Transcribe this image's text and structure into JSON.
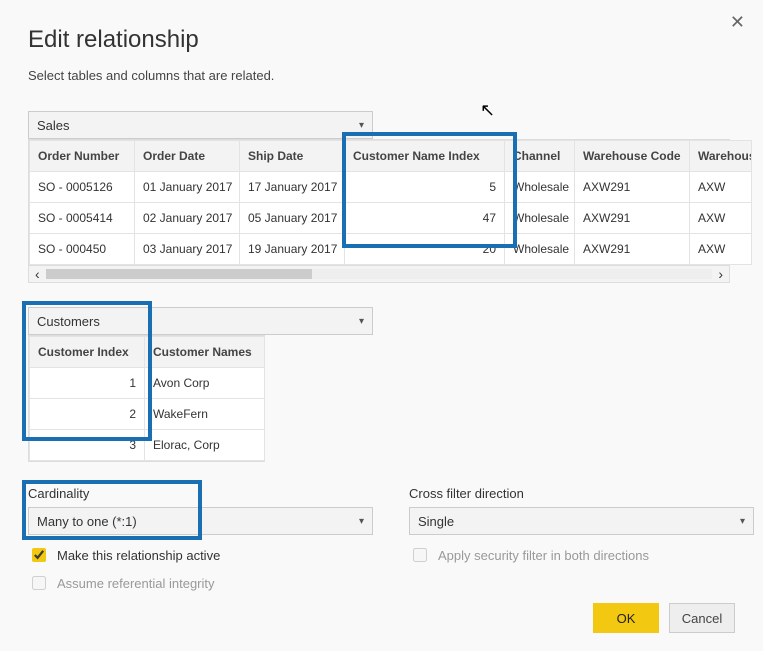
{
  "dialog": {
    "title": "Edit relationship",
    "subtitle": "Select tables and columns that are related.",
    "close_label": "✕"
  },
  "table1": {
    "name": "Sales",
    "headers": [
      "Order Number",
      "Order Date",
      "Ship Date",
      "Customer Name Index",
      "Channel",
      "Warehouse Code",
      "Warehouse"
    ],
    "rows": [
      {
        "c0": "SO - 0005126",
        "c1": "01 January 2017",
        "c2": "17 January 2017",
        "c3": "5",
        "c4": "Wholesale",
        "c5": "AXW291",
        "c6": "AXW"
      },
      {
        "c0": "SO - 0005414",
        "c1": "02 January 2017",
        "c2": "05 January 2017",
        "c3": "47",
        "c4": "Wholesale",
        "c5": "AXW291",
        "c6": "AXW"
      },
      {
        "c0": "SO - 000450",
        "c1": "03 January 2017",
        "c2": "19 January 2017",
        "c3": "20",
        "c4": "Wholesale",
        "c5": "AXW291",
        "c6": "AXW"
      }
    ]
  },
  "table2": {
    "name": "Customers",
    "headers": [
      "Customer Index",
      "Customer Names"
    ],
    "rows": [
      {
        "c0": "1",
        "c1": "Avon Corp"
      },
      {
        "c0": "2",
        "c1": "WakeFern"
      },
      {
        "c0": "3",
        "c1": "Elorac, Corp"
      }
    ]
  },
  "cardinality": {
    "label": "Cardinality",
    "value": "Many to one (*:1)"
  },
  "crossfilter": {
    "label": "Cross filter direction",
    "value": "Single"
  },
  "checks": {
    "active": "Make this relationship active",
    "security": "Apply security filter in both directions",
    "referential": "Assume referential integrity"
  },
  "buttons": {
    "ok": "OK",
    "cancel": "Cancel"
  }
}
